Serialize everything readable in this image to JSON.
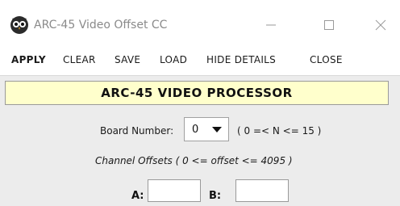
{
  "window": {
    "title": "ARC-45 Video Offset CC",
    "app_icon": "owl-logo-icon",
    "controls": {
      "minimize": "minimize-icon",
      "maximize": "maximize-icon",
      "close": "close-icon"
    }
  },
  "menu": {
    "items": [
      {
        "label": "APPLY",
        "bold": true
      },
      {
        "label": "CLEAR",
        "bold": false
      },
      {
        "label": "SAVE",
        "bold": false
      },
      {
        "label": "LOAD",
        "bold": false
      },
      {
        "label": "HIDE DETAILS",
        "bold": false
      },
      {
        "label": "CLOSE",
        "bold": false
      }
    ]
  },
  "panel": {
    "banner": "ARC-45 VIDEO PROCESSOR",
    "banner_bg": "#ffffcc",
    "board_label": "Board Number:",
    "board_value": "0",
    "board_range": "( 0 =< N <= 15 )",
    "offsets_label": "Channel Offsets ( 0 <= offset <= 4095 )",
    "channel_a_label": "A:",
    "channel_a_value": "",
    "channel_b_label": "B:",
    "channel_b_value": ""
  }
}
